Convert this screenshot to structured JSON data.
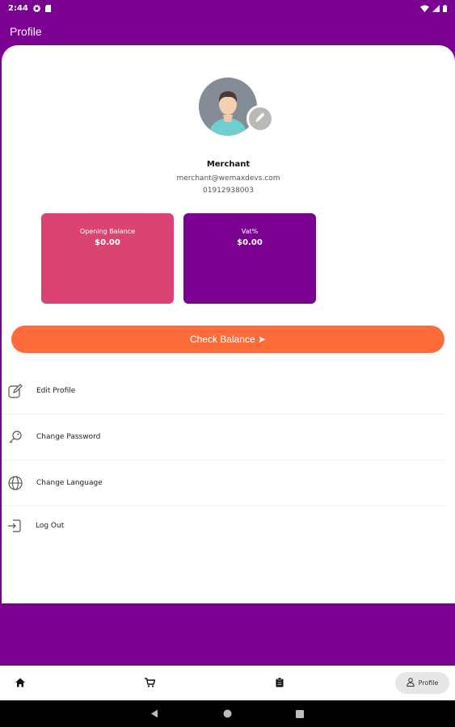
{
  "status_bar": {
    "time": "2:44",
    "icons_left": [
      "settings-icon",
      "sim-card-icon"
    ],
    "icons_right": [
      "wifi-icon",
      "signal-icon",
      "battery-icon"
    ]
  },
  "app_bar": {
    "title": "Profile"
  },
  "colors": {
    "primary": "#7a0090",
    "opening_card": "#da4473",
    "vat_card": "#7a0090",
    "check_balance": "#ff6c3b"
  },
  "profile": {
    "name": "Merchant",
    "email": "merchant@wemaxdevs.com",
    "phone": "01912938003"
  },
  "stats": {
    "opening_balance": {
      "label": "Opening Balance",
      "value": "$0.00"
    },
    "vat": {
      "label": "Vat%",
      "value": "$0.00"
    }
  },
  "check_balance": {
    "label": "Check Balance ➤"
  },
  "menu": [
    {
      "label": "Edit Profile",
      "icon": "edit-icon"
    },
    {
      "label": "Change Password",
      "icon": "key-icon"
    },
    {
      "label": "Change Language",
      "icon": "globe-icon"
    },
    {
      "label": "Log Out",
      "icon": "logout-icon"
    }
  ],
  "bottom_nav": {
    "items": [
      {
        "name": "home",
        "icon": "home-icon"
      },
      {
        "name": "cart",
        "icon": "cart-icon"
      },
      {
        "name": "orders",
        "icon": "clipboard-icon"
      },
      {
        "name": "profile",
        "icon": "person-icon",
        "label": "Profile",
        "active": true
      }
    ]
  },
  "system_nav": [
    "back-icon",
    "home-circle-icon",
    "recents-icon"
  ]
}
